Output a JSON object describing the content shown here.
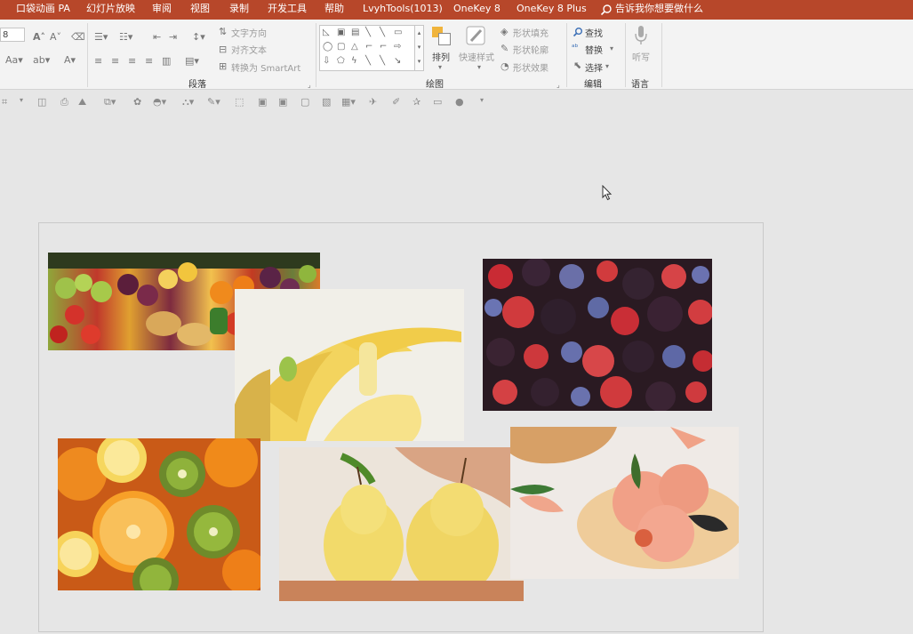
{
  "menubar": {
    "items": [
      "口袋动画 PA",
      "幻灯片放映",
      "审阅",
      "视图",
      "录制",
      "开发工具",
      "帮助",
      "LvyhTools(1013)",
      "OneKey 8",
      "OneKey 8 Plus"
    ],
    "tell_me": "告诉我你想要做什么",
    "bg": "#b7472a"
  },
  "ribbon": {
    "font_size_value": "8",
    "paragraph": {
      "text_direction": "文字方向",
      "align_text": "对齐文本",
      "convert_smartart": "转换为 SmartArt",
      "label": "段落"
    },
    "drawing": {
      "arrange": "排列",
      "quick_styles": "快速样式",
      "shape_fill": "形状填充",
      "shape_outline": "形状轮廓",
      "shape_effects": "形状效果",
      "label": "绘图"
    },
    "editing": {
      "find": "查找",
      "replace": "替换",
      "select": "选择",
      "label": "编辑"
    },
    "voice": {
      "dictate": "听写",
      "label": "语言"
    }
  },
  "slide": {
    "images": [
      "mixed-fruits-photo",
      "banana-photo",
      "berries-photo",
      "citrus-kiwi-photo",
      "pears-photo",
      "peaches-photo"
    ]
  }
}
